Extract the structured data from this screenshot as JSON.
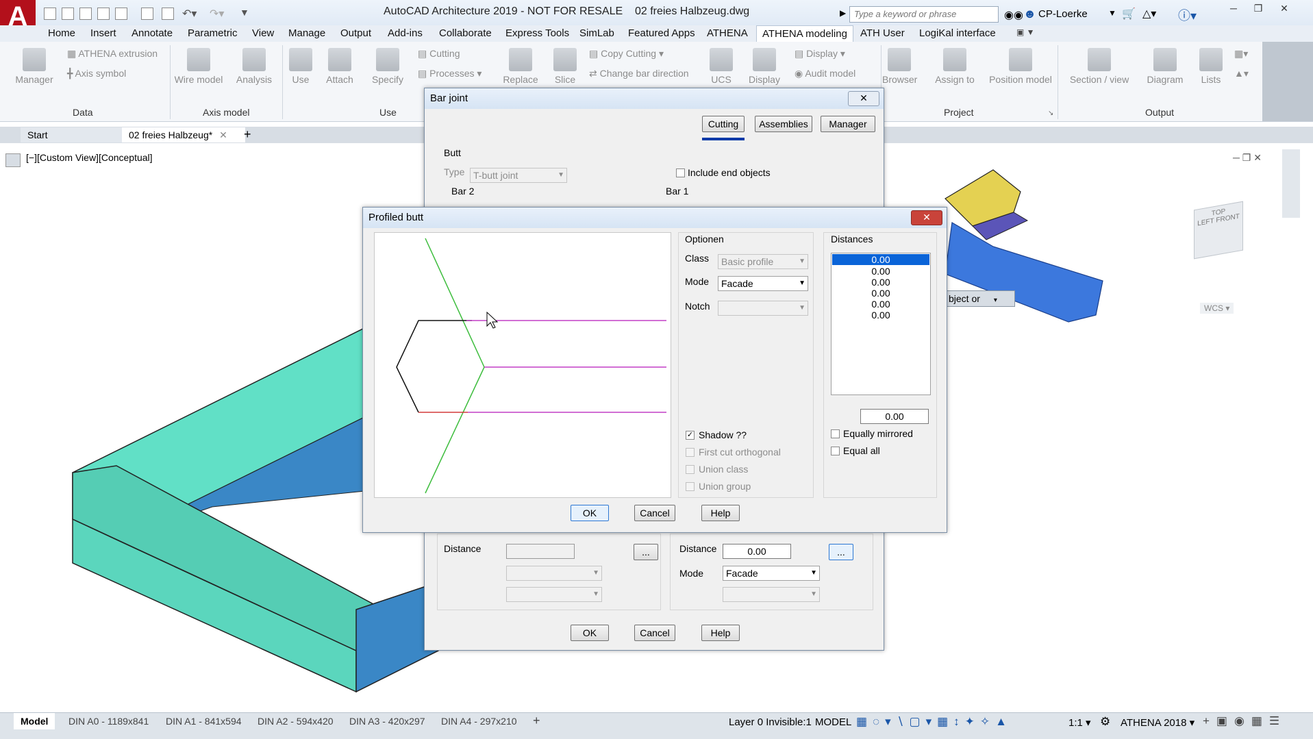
{
  "app": {
    "title": "AutoCAD Architecture 2019 - NOT FOR RESALE",
    "file": "02 freies Halbzeug.dwg",
    "search_placeholder": "Type a keyword or phrase",
    "user": "CP-Loerke",
    "logo": "A"
  },
  "menu_tabs": [
    "Home",
    "Insert",
    "Annotate",
    "Parametric",
    "View",
    "Manage",
    "Output",
    "Add-ins",
    "Collaborate",
    "Express Tools",
    "SimLab",
    "Featured Apps",
    "ATHENA",
    "ATHENA modeling",
    "ATH User",
    "LogiKal interface"
  ],
  "ribbon": {
    "data": {
      "manager": "Manager",
      "athena_extrusion": "ATHENA extrusion",
      "axis_symbol": "Axis symbol",
      "group": "Data"
    },
    "axis_model": {
      "wire_model": "Wire model",
      "analysis": "Analysis",
      "group": "Axis model"
    },
    "use": {
      "use": "Use",
      "attach": "Attach",
      "specify": "Specify",
      "cutting": "Cutting",
      "processes": "Processes",
      "group": "Use"
    },
    "edit": {
      "replace": "Replace",
      "slice": "Slice",
      "copy_cutting": "Copy Cutting",
      "change_bar_direction": "Change bar direction"
    },
    "view": {
      "ucs": "UCS",
      "display": "Display",
      "display_small": "Display",
      "audit_model": "Audit model"
    },
    "project": {
      "browser": "Browser",
      "assign_to": "Assign to",
      "position_model": "Position model",
      "group": "Project"
    },
    "output": {
      "section_view": "Section / view",
      "diagram": "Diagram",
      "lists": "Lists",
      "group": "Output"
    }
  },
  "doc_tabs": {
    "start": "Start",
    "active": "02 freies Halbzeug*"
  },
  "viewport": {
    "label": "[−][Custom View][Conceptual]",
    "viewcube_top": "TOP",
    "viewcube_left": "LEFT",
    "viewcube_front": "FRONT",
    "wcs": "WCS",
    "tooltip_fragment": "bject or"
  },
  "bar_joint": {
    "title": "Bar joint",
    "tabs": {
      "cutting": "Cutting",
      "assemblies": "Assemblies",
      "manager": "Manager"
    },
    "butt": "Butt",
    "type_label": "Type",
    "type_value": "T-butt joint",
    "include_end_objects": "Include end objects",
    "bar2": "Bar 2",
    "bar1": "Bar 1",
    "distance_label": "Distance",
    "distance_right": "0.00",
    "ellipsis": "...",
    "mode_label": "Mode",
    "mode_value": "Facade",
    "ok": "OK",
    "cancel": "Cancel",
    "help": "Help"
  },
  "profiled_butt": {
    "title": "Profiled butt",
    "optionen": "Optionen",
    "class_label": "Class",
    "class_value": "Basic profile",
    "mode_label": "Mode",
    "mode_value": "Facade",
    "notch_label": "Notch",
    "notch_value": "",
    "shadow": "Shadow ??",
    "first_cut_orthogonal": "First cut orthogonal",
    "union_class": "Union class",
    "union_group": "Union group",
    "distances_label": "Distances",
    "distances": [
      "0.00",
      "0.00",
      "0.00",
      "0.00",
      "0.00",
      "0.00"
    ],
    "distance_value": "0.00",
    "equally_mirrored": "Equally mirrored",
    "equal_all": "Equal all",
    "ok": "OK",
    "cancel": "Cancel",
    "help": "Help"
  },
  "status": {
    "tabs": [
      "Model",
      "DIN A0 - 1189x841",
      "DIN A1 - 841x594",
      "DIN A2 - 594x420",
      "DIN A3 - 420x297",
      "DIN A4 - 297x210"
    ],
    "layer": "Layer 0 Invisible:1",
    "model": "MODEL",
    "scale": "1:1",
    "workspace": "ATHENA 2018"
  },
  "colors": {
    "accent": "#0a3aa8",
    "profile_magenta": "#c23fc6",
    "profile_green": "#3dbd3d",
    "profile_red": "#d43a3a",
    "frame_teal": "#61e0c6",
    "frame_blue": "#3a87c6"
  }
}
